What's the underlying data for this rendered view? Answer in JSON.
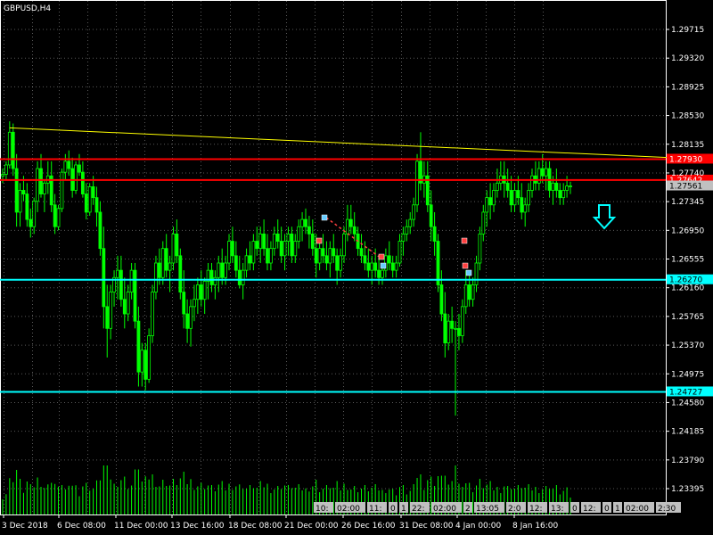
{
  "window": {
    "title": "GBPUSD,H4"
  },
  "colors": {
    "background": "#000000",
    "grid": "#ffffff",
    "candle": "#00ff00",
    "volume": "#00ff00",
    "resistance": "#ff0000",
    "support": "#00ffff",
    "trendline": "#ffff00",
    "bid": "#c0c0c0",
    "label_text": "#ffffff",
    "arrow": "#00ffff"
  },
  "chart_data": {
    "type": "candlestick",
    "symbol": "GBPUSD",
    "timeframe": "H4",
    "ylim": [
      1.232,
      1.304
    ],
    "y_ticks": [
      "1.29715",
      "1.29320",
      "1.28925",
      "1.28530",
      "1.28135",
      "1.27740",
      "1.27345",
      "1.26950",
      "1.26555",
      "1.26160",
      "1.25765",
      "1.25370",
      "1.24975",
      "1.24580",
      "1.24185",
      "1.23790",
      "1.23395"
    ],
    "x_ticks": [
      "3 Dec 2018",
      "6 Dec 08:00",
      "11 Dec 00:00",
      "13 Dec 16:00",
      "18 Dec 08:00",
      "21 Dec 00:00",
      "26 Dec 16:00",
      "31 Dec 08:00",
      "4 Jan 00:00",
      "8 Jan 16:00"
    ],
    "price_lines": [
      {
        "kind": "resistance",
        "price": 1.2793,
        "label": "1.27930"
      },
      {
        "kind": "resistance",
        "price": 1.27642,
        "label": "1.27642"
      },
      {
        "kind": "bid",
        "price": 1.27561,
        "label": "1.27561"
      },
      {
        "kind": "support",
        "price": 1.2627,
        "label": "1.26270"
      },
      {
        "kind": "support",
        "price": 1.24727,
        "label": "1.24727"
      }
    ],
    "trendline": {
      "from": {
        "bar": 2,
        "price": 1.2836
      },
      "to": {
        "bar": 215,
        "price": 1.279
      }
    },
    "signal": {
      "direction": "sell",
      "icon": "down-arrow-icon"
    },
    "bottom_time_labels": [
      "10:",
      "02:00",
      "11:",
      "0",
      "1",
      "22:",
      "02:00",
      "2",
      "13:05",
      "2:0",
      "12:",
      "13:",
      "0",
      "12:",
      "0",
      "1",
      "02:00",
      "2:30"
    ],
    "candles": [
      [
        1.277,
        1.278,
        1.276,
        1.2772
      ],
      [
        1.2772,
        1.279,
        1.2765,
        1.2785
      ],
      [
        1.2785,
        1.2845,
        1.278,
        1.283
      ],
      [
        1.283,
        1.2842,
        1.277,
        1.278
      ],
      [
        1.278,
        1.28,
        1.27,
        1.272
      ],
      [
        1.272,
        1.276,
        1.27,
        1.275
      ],
      [
        1.275,
        1.277,
        1.2735,
        1.2745
      ],
      [
        1.2745,
        1.276,
        1.27,
        1.271
      ],
      [
        1.271,
        1.2725,
        1.2685,
        1.27
      ],
      [
        1.27,
        1.274,
        1.269,
        1.2735
      ],
      [
        1.2735,
        1.279,
        1.272,
        1.278
      ],
      [
        1.278,
        1.28,
        1.274,
        1.2745
      ],
      [
        1.2745,
        1.2765,
        1.272,
        1.276
      ],
      [
        1.276,
        1.279,
        1.2745,
        1.277
      ],
      [
        1.277,
        1.279,
        1.272,
        1.273
      ],
      [
        1.273,
        1.2745,
        1.269,
        1.27
      ],
      [
        1.27,
        1.273,
        1.2695,
        1.2725
      ],
      [
        1.2725,
        1.278,
        1.272,
        1.2775
      ],
      [
        1.2775,
        1.28,
        1.2765,
        1.279
      ],
      [
        1.279,
        1.2805,
        1.277,
        1.278
      ],
      [
        1.278,
        1.2795,
        1.274,
        1.275
      ],
      [
        1.275,
        1.279,
        1.2745,
        1.2785
      ],
      [
        1.2785,
        1.28,
        1.277,
        1.2775
      ],
      [
        1.2775,
        1.279,
        1.274,
        1.2745
      ],
      [
        1.2745,
        1.276,
        1.271,
        1.272
      ],
      [
        1.272,
        1.276,
        1.2715,
        1.2755
      ],
      [
        1.2755,
        1.277,
        1.273,
        1.274
      ],
      [
        1.274,
        1.2755,
        1.27,
        1.272
      ],
      [
        1.272,
        1.2735,
        1.266,
        1.267
      ],
      [
        1.267,
        1.27,
        1.256,
        1.259
      ],
      [
        1.259,
        1.262,
        1.252,
        1.256
      ],
      [
        1.256,
        1.262,
        1.2545,
        1.261
      ],
      [
        1.261,
        1.264,
        1.259,
        1.263
      ],
      [
        1.263,
        1.266,
        1.26,
        1.264
      ],
      [
        1.264,
        1.266,
        1.259,
        1.26
      ],
      [
        1.26,
        1.263,
        1.256,
        1.258
      ],
      [
        1.258,
        1.262,
        1.257,
        1.261
      ],
      [
        1.261,
        1.265,
        1.26,
        1.264
      ],
      [
        1.264,
        1.265,
        1.256,
        1.257
      ],
      [
        1.257,
        1.259,
        1.248,
        1.25
      ],
      [
        1.25,
        1.254,
        1.248,
        1.253
      ],
      [
        1.253,
        1.254,
        1.2475,
        1.249
      ],
      [
        1.249,
        1.256,
        1.2485,
        1.255
      ],
      [
        1.255,
        1.262,
        1.254,
        1.261
      ],
      [
        1.261,
        1.266,
        1.26,
        1.265
      ],
      [
        1.265,
        1.267,
        1.262,
        1.263
      ],
      [
        1.263,
        1.268,
        1.262,
        1.267
      ],
      [
        1.267,
        1.269,
        1.263,
        1.264
      ],
      [
        1.264,
        1.266,
        1.261,
        1.265
      ],
      [
        1.265,
        1.27,
        1.264,
        1.269
      ],
      [
        1.269,
        1.271,
        1.265,
        1.266
      ],
      [
        1.266,
        1.267,
        1.26,
        1.261
      ],
      [
        1.261,
        1.264,
        1.256,
        1.258
      ],
      [
        1.258,
        1.26,
        1.254,
        1.256
      ],
      [
        1.256,
        1.26,
        1.2535,
        1.259
      ],
      [
        1.259,
        1.262,
        1.257,
        1.26
      ],
      [
        1.26,
        1.263,
        1.258,
        1.262
      ],
      [
        1.262,
        1.264,
        1.259,
        1.26
      ],
      [
        1.26,
        1.263,
        1.258,
        1.2625
      ],
      [
        1.2625,
        1.265,
        1.26,
        1.264
      ],
      [
        1.264,
        1.265,
        1.261,
        1.262
      ],
      [
        1.262,
        1.264,
        1.26,
        1.263
      ],
      [
        1.263,
        1.266,
        1.261,
        1.265
      ],
      [
        1.265,
        1.267,
        1.262,
        1.263
      ],
      [
        1.263,
        1.266,
        1.262,
        1.265
      ],
      [
        1.265,
        1.269,
        1.264,
        1.268
      ],
      [
        1.268,
        1.27,
        1.265,
        1.266
      ],
      [
        1.266,
        1.268,
        1.263,
        1.264
      ],
      [
        1.264,
        1.266,
        1.2615,
        1.262
      ],
      [
        1.262,
        1.265,
        1.26,
        1.264
      ],
      [
        1.264,
        1.267,
        1.263,
        1.266
      ],
      [
        1.266,
        1.268,
        1.264,
        1.265
      ],
      [
        1.265,
        1.269,
        1.264,
        1.268
      ],
      [
        1.268,
        1.27,
        1.266,
        1.267
      ],
      [
        1.267,
        1.27,
        1.265,
        1.269
      ],
      [
        1.269,
        1.271,
        1.266,
        1.267
      ],
      [
        1.267,
        1.269,
        1.264,
        1.265
      ],
      [
        1.265,
        1.268,
        1.264,
        1.267
      ],
      [
        1.267,
        1.27,
        1.266,
        1.269
      ],
      [
        1.269,
        1.271,
        1.267,
        1.268
      ],
      [
        1.268,
        1.27,
        1.265,
        1.266
      ],
      [
        1.266,
        1.269,
        1.264,
        1.268
      ],
      [
        1.268,
        1.27,
        1.266,
        1.269
      ],
      [
        1.269,
        1.27,
        1.265,
        1.266
      ],
      [
        1.266,
        1.269,
        1.265,
        1.268
      ],
      [
        1.268,
        1.271,
        1.267,
        1.27
      ],
      [
        1.27,
        1.272,
        1.268,
        1.271
      ],
      [
        1.271,
        1.2725,
        1.269,
        1.27
      ],
      [
        1.27,
        1.2715,
        1.267,
        1.269
      ],
      [
        1.269,
        1.271,
        1.266,
        1.267
      ],
      [
        1.267,
        1.269,
        1.263,
        1.265
      ],
      [
        1.265,
        1.268,
        1.264,
        1.267
      ],
      [
        1.267,
        1.269,
        1.265,
        1.266
      ],
      [
        1.266,
        1.268,
        1.264,
        1.265
      ],
      [
        1.265,
        1.268,
        1.263,
        1.267
      ],
      [
        1.267,
        1.269,
        1.265,
        1.266
      ],
      [
        1.266,
        1.267,
        1.262,
        1.264
      ],
      [
        1.264,
        1.267,
        1.263,
        1.266
      ],
      [
        1.266,
        1.27,
        1.265,
        1.269
      ],
      [
        1.269,
        1.273,
        1.268,
        1.271
      ],
      [
        1.271,
        1.273,
        1.269,
        1.27
      ],
      [
        1.27,
        1.272,
        1.268,
        1.269
      ],
      [
        1.269,
        1.27,
        1.266,
        1.267
      ],
      [
        1.267,
        1.269,
        1.265,
        1.266
      ],
      [
        1.266,
        1.268,
        1.264,
        1.265
      ],
      [
        1.265,
        1.267,
        1.263,
        1.264
      ],
      [
        1.264,
        1.266,
        1.262,
        1.265
      ],
      [
        1.265,
        1.267,
        1.263,
        1.264
      ],
      [
        1.264,
        1.266,
        1.262,
        1.263
      ],
      [
        1.263,
        1.265,
        1.262,
        1.264
      ],
      [
        1.264,
        1.267,
        1.263,
        1.266
      ],
      [
        1.266,
        1.268,
        1.264,
        1.265
      ],
      [
        1.265,
        1.266,
        1.263,
        1.264
      ],
      [
        1.264,
        1.266,
        1.263,
        1.265
      ],
      [
        1.265,
        1.269,
        1.2645,
        1.268
      ],
      [
        1.268,
        1.27,
        1.266,
        1.269
      ],
      [
        1.269,
        1.271,
        1.268,
        1.27
      ],
      [
        1.27,
        1.272,
        1.269,
        1.271
      ],
      [
        1.271,
        1.274,
        1.27,
        1.273
      ],
      [
        1.273,
        1.28,
        1.272,
        1.279
      ],
      [
        1.279,
        1.283,
        1.275,
        1.276
      ],
      [
        1.276,
        1.279,
        1.274,
        1.277
      ],
      [
        1.277,
        1.279,
        1.272,
        1.273
      ],
      [
        1.273,
        1.275,
        1.268,
        1.27
      ],
      [
        1.27,
        1.272,
        1.266,
        1.268
      ],
      [
        1.268,
        1.269,
        1.261,
        1.262
      ],
      [
        1.262,
        1.264,
        1.257,
        1.258
      ],
      [
        1.258,
        1.261,
        1.252,
        1.254
      ],
      [
        1.254,
        1.258,
        1.253,
        1.257
      ],
      [
        1.257,
        1.259,
        1.254,
        1.256
      ],
      [
        1.256,
        1.257,
        1.244,
        1.256
      ],
      [
        1.256,
        1.258,
        1.253,
        1.255
      ],
      [
        1.255,
        1.26,
        1.254,
        1.259
      ],
      [
        1.259,
        1.264,
        1.258,
        1.262
      ],
      [
        1.262,
        1.264,
        1.259,
        1.26
      ],
      [
        1.26,
        1.263,
        1.259,
        1.262
      ],
      [
        1.262,
        1.266,
        1.261,
        1.265
      ],
      [
        1.265,
        1.27,
        1.264,
        1.269
      ],
      [
        1.269,
        1.273,
        1.268,
        1.272
      ],
      [
        1.272,
        1.275,
        1.27,
        1.274
      ],
      [
        1.274,
        1.276,
        1.271,
        1.273
      ],
      [
        1.273,
        1.276,
        1.272,
        1.275
      ],
      [
        1.275,
        1.278,
        1.274,
        1.276
      ],
      [
        1.276,
        1.279,
        1.275,
        1.277
      ],
      [
        1.277,
        1.279,
        1.274,
        1.276
      ],
      [
        1.276,
        1.278,
        1.274,
        1.275
      ],
      [
        1.275,
        1.277,
        1.272,
        1.273
      ],
      [
        1.273,
        1.276,
        1.272,
        1.275
      ],
      [
        1.275,
        1.277,
        1.273,
        1.274
      ],
      [
        1.274,
        1.276,
        1.271,
        1.272
      ],
      [
        1.272,
        1.274,
        1.27,
        1.273
      ],
      [
        1.273,
        1.276,
        1.272,
        1.275
      ],
      [
        1.275,
        1.278,
        1.274,
        1.277
      ],
      [
        1.277,
        1.279,
        1.275,
        1.276
      ],
      [
        1.276,
        1.279,
        1.275,
        1.278
      ],
      [
        1.278,
        1.28,
        1.276,
        1.277
      ],
      [
        1.277,
        1.279,
        1.275,
        1.278
      ],
      [
        1.278,
        1.279,
        1.274,
        1.275
      ],
      [
        1.275,
        1.277,
        1.273,
        1.276
      ],
      [
        1.276,
        1.278,
        1.274,
        1.275
      ],
      [
        1.275,
        1.276,
        1.273,
        1.274
      ],
      [
        1.274,
        1.276,
        1.273,
        1.275
      ],
      [
        1.275,
        1.277,
        1.274,
        1.2756
      ],
      [
        1.2756,
        1.2762,
        1.2745,
        1.2756
      ]
    ]
  }
}
